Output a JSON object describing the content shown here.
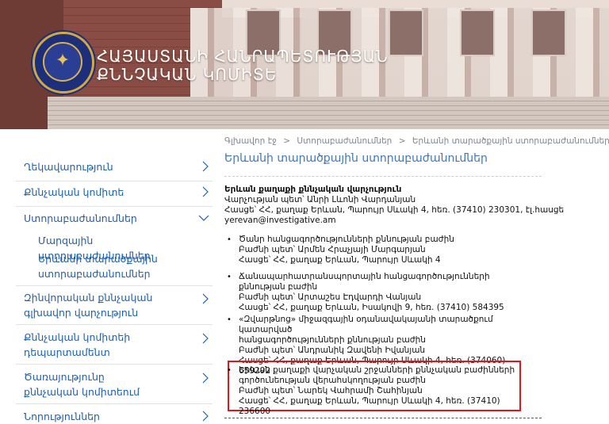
{
  "header": {
    "title_line1": "ՀԱՅԱՍՏԱՆԻ ՀԱՆՐԱՊԵՏՈՒԹՅԱՆ",
    "title_line2": "ՔՆՆՉԱԿԱՆ ԿՈՄԻՏԵ"
  },
  "sidebar": {
    "items": [
      {
        "label": "Ղեկավարություն"
      },
      {
        "label": "Քննչական կոմիտե"
      },
      {
        "label": "Ստորաբաժանումներ"
      },
      {
        "label": "Մարզային ստորաբաժանումներ"
      },
      {
        "label": "Երևանի տարածքային ստորաբաժանումներ"
      },
      {
        "label": "Զինվորական քննչական գլխավոր վարչություն"
      },
      {
        "label": "Քննչական կոմիտեի դեպարտամենտ"
      },
      {
        "label": "Ծառայությունը քննչական կոմիտեում"
      },
      {
        "label": "Նորություններ"
      }
    ]
  },
  "breadcrumb": {
    "home": "Գլխավոր էջ",
    "parent": "Ստորաբաժանումներ",
    "current": "Երևանի տարածքային ստորաբաժանումներ",
    "separator": ">"
  },
  "page": {
    "title": "Երևանի տարածքային ստորաբաժանումներ"
  },
  "organization": {
    "name": "Երևան քաղաքի քննչական վարչություն",
    "head": "Վարչության պետ՝ Անրի Լևոնի Վարդանյան",
    "address": "Հասցե՝ ՀՀ, քաղաք Երևան,  Պարույր Սևակի 4, հեռ. (37410) 230301,  էլ.հասցե yerevan@investigative.am"
  },
  "departments": [
    {
      "name": "Ծանր հանցագործությունների քննության բաժին",
      "head": "Բաժնի պետ՝ Արմեն Հրաչյայի Մարգարյան",
      "address": "Հասցե՝ ՀՀ, քաղաք Երևան,  Պարույր Սևակի 4"
    },
    {
      "name": "Ճանապարհատրանսպորտային հանցագործությունների քննության բաժին",
      "head": "Բաժնի պետ՝ Արտաշես Էդվարդի Վանյան",
      "address": "Հասցե՝ ՀՀ, քաղաք Երևան,  Իսակովի 9, հեռ. (37410) 584395"
    },
    {
      "name_line1": "«Զվարթնոց» միջազգային օդանավակայանի տարածքում կատարված",
      "name_line2": "հանցագործությունների քննության բաժին",
      "head": "Բաժնի պետ՝ Անդրանիկ Զավենի Իվանյան",
      "address": "Հասցե՝ ՀՀ, քաղաք Երևան,  Պարույր Սևակի 4, հեռ. (374060) 659292"
    },
    {
      "name_line1": "Երևան քաղաքի վարչական շրջանների քննչական բաժինների",
      "name_line2": "գործունեության վերահսկողության բաժին",
      "head": "Բաժնի պետ՝ Նարեկ Վահրամի Շահինյան",
      "address": "Հասցե՝ ՀՀ, քաղաք Երևան,  Պարույր Սևակի 4, հեռ. (37410) 236600"
    }
  ],
  "icons": {
    "bullet": "•"
  },
  "colors": {
    "link": "#1e5fb2",
    "title": "#3f77bd",
    "highlight": "#e5141a",
    "seal_blue": "#1d2f7a",
    "seal_gold": "#d2a93a"
  }
}
